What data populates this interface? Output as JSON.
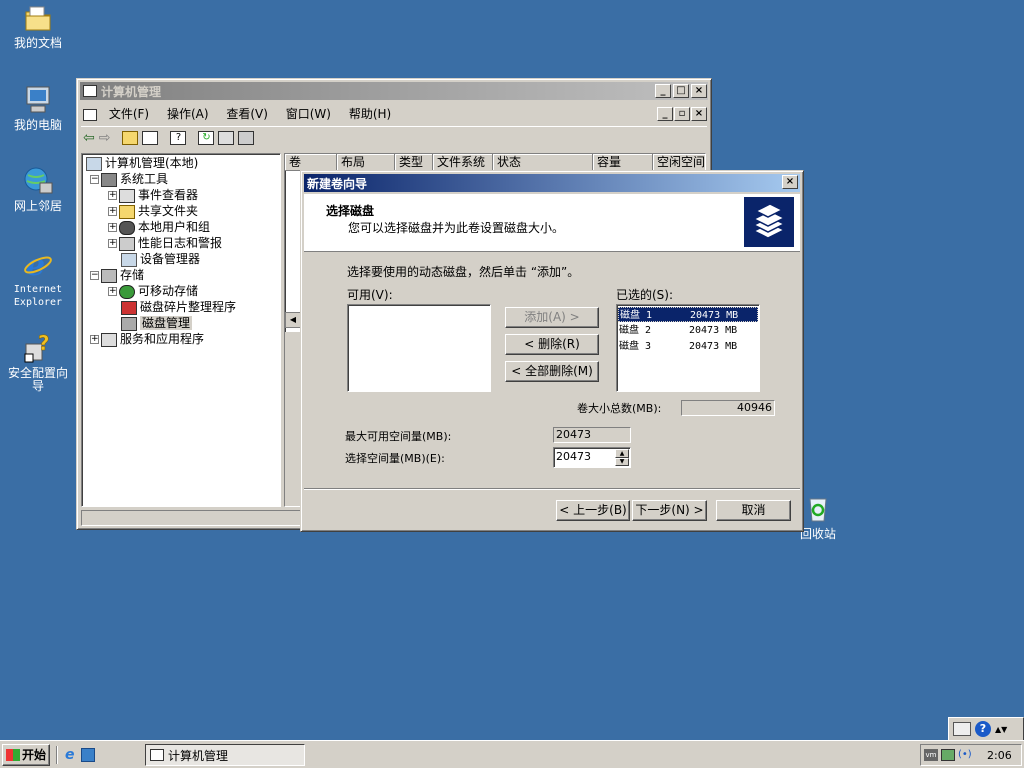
{
  "desktop": {
    "icons": [
      {
        "label": "我的文档",
        "icon": "my-documents-icon"
      },
      {
        "label": "我的电脑",
        "icon": "my-computer-icon"
      },
      {
        "label": "网上邻居",
        "icon": "network-places-icon"
      },
      {
        "label": "Internet Explorer",
        "icon": "internet-explorer-icon"
      },
      {
        "label": "安全配置向导",
        "icon": "security-wizard-icon"
      },
      {
        "label": "回收站",
        "icon": "recycle-bin-icon"
      }
    ]
  },
  "main_window": {
    "title": "计算机管理",
    "menu": [
      "文件(F)",
      "操作(A)",
      "查看(V)",
      "窗口(W)",
      "帮助(H)"
    ],
    "tree": [
      {
        "label": "计算机管理(本地)"
      },
      {
        "label": "系统工具"
      },
      {
        "label": "事件查看器"
      },
      {
        "label": "共享文件夹"
      },
      {
        "label": "本地用户和组"
      },
      {
        "label": "性能日志和警报"
      },
      {
        "label": "设备管理器"
      },
      {
        "label": "存储"
      },
      {
        "label": "可移动存储"
      },
      {
        "label": "磁盘碎片整理程序"
      },
      {
        "label": "磁盘管理"
      },
      {
        "label": "服务和应用程序"
      }
    ],
    "columns": [
      "卷",
      "布局",
      "类型",
      "文件系统",
      "状态",
      "容量",
      "空闲空间"
    ]
  },
  "wizard": {
    "title": "新建卷向导",
    "heading": "选择磁盘",
    "subheading": "您可以选择磁盘并为此卷设置磁盘大小。",
    "instruction": "选择要使用的动态磁盘，然后单击 “添加”。",
    "available_label": "可用(V):",
    "selected_label": "已选的(S):",
    "add_button": "添加(A) >",
    "remove_button": "< 删除(R)",
    "remove_all_button": "< 全部删除(M)",
    "selected_disks": [
      {
        "name": "磁盘 1",
        "size": "20473 MB"
      },
      {
        "name": "磁盘 2",
        "size": "20473 MB"
      },
      {
        "name": "磁盘 3",
        "size": "20473 MB"
      }
    ],
    "total_label": "卷大小总数(MB):",
    "total_value": "40946",
    "max_label": "最大可用空间量(MB):",
    "max_value": "20473",
    "select_label": "选择空间量(MB)(E):",
    "select_value": "20473",
    "back_button": "< 上一步(B)",
    "next_button": "下一步(N) >",
    "cancel_button": "取消"
  },
  "taskbar": {
    "start": "开始",
    "task": "计算机管理",
    "clock": "2:06"
  }
}
